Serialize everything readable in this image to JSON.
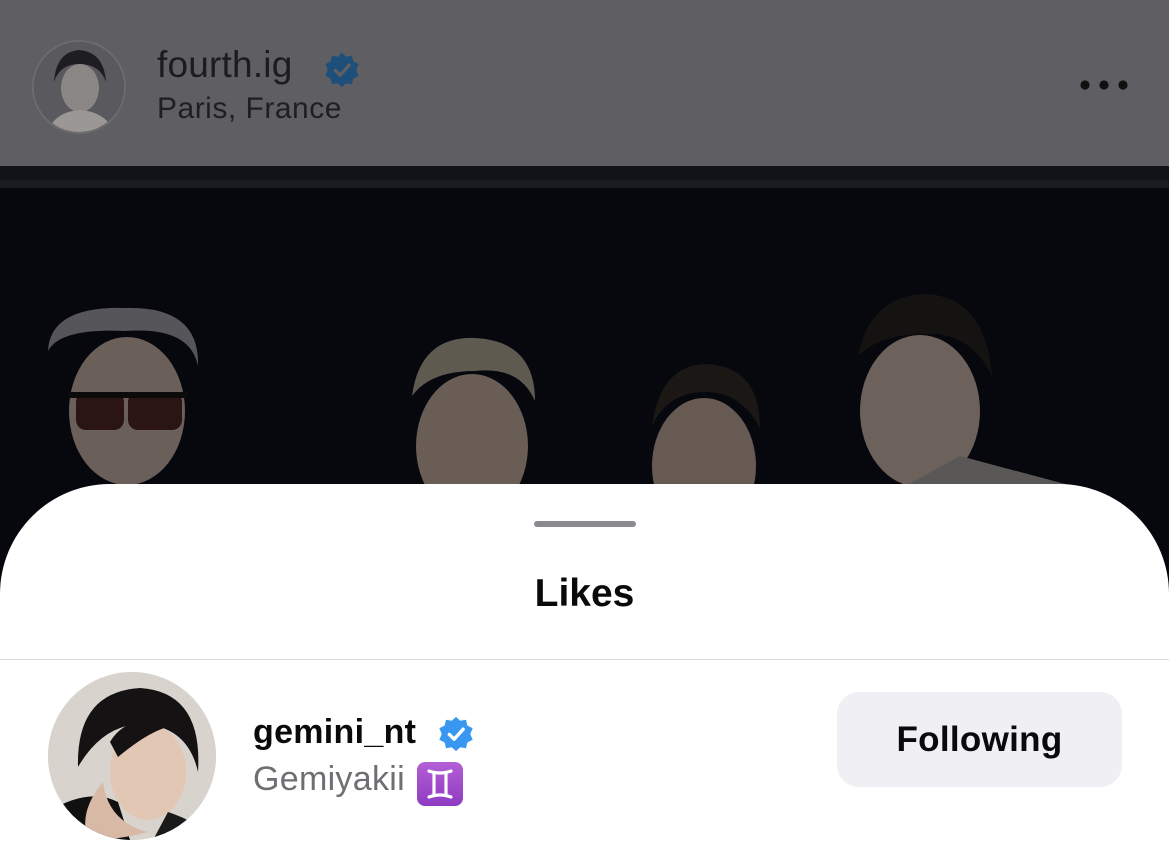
{
  "post": {
    "username": "fourth.ig",
    "location": "Paris, France",
    "more_icon": "more-horizontal-icon",
    "verified_icon": "verified-badge-icon"
  },
  "likes_sheet": {
    "title": "Likes",
    "users": [
      {
        "username": "gemini_nt",
        "name": "Gemiyakii",
        "name_emoji": "gemini-zodiac-icon",
        "verified": true,
        "action_label": "Following"
      }
    ]
  },
  "colors": {
    "verified_blue": "#3897f0",
    "dim_overlay": "#5f5f63",
    "button_bg": "#efeff4"
  }
}
